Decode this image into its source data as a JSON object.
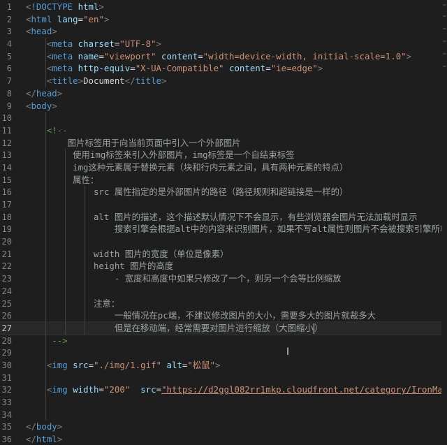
{
  "editor": {
    "language": "html",
    "current_line": 27,
    "lines": [
      {
        "n": "1",
        "indent": 0,
        "segs": [
          [
            "br",
            "<"
          ],
          [
            "tag",
            "!DOCTYPE"
          ],
          [
            "txt",
            " "
          ],
          [
            "attr",
            "html"
          ],
          [
            "br",
            ">"
          ]
        ]
      },
      {
        "n": "2",
        "indent": 0,
        "segs": [
          [
            "br",
            "<"
          ],
          [
            "tag",
            "html"
          ],
          [
            "txt",
            " "
          ],
          [
            "attr",
            "lang"
          ],
          [
            "txt",
            "="
          ],
          [
            "str",
            "\"en\""
          ],
          [
            "br",
            ">"
          ]
        ]
      },
      {
        "n": "3",
        "indent": 0,
        "segs": [
          [
            "br",
            "<"
          ],
          [
            "tag",
            "head"
          ],
          [
            "br",
            ">"
          ]
        ]
      },
      {
        "n": "4",
        "indent": 1,
        "segs": [
          [
            "br",
            "<"
          ],
          [
            "tag",
            "meta"
          ],
          [
            "txt",
            " "
          ],
          [
            "attr",
            "charset"
          ],
          [
            "txt",
            "="
          ],
          [
            "str",
            "\"UTF-8\""
          ],
          [
            "br",
            ">"
          ]
        ]
      },
      {
        "n": "5",
        "indent": 1,
        "segs": [
          [
            "br",
            "<"
          ],
          [
            "tag",
            "meta"
          ],
          [
            "txt",
            " "
          ],
          [
            "attr",
            "name"
          ],
          [
            "txt",
            "="
          ],
          [
            "str",
            "\"viewport\""
          ],
          [
            "txt",
            " "
          ],
          [
            "attr",
            "content"
          ],
          [
            "txt",
            "="
          ],
          [
            "str",
            "\"width=device-width, initial-scale=1.0\""
          ],
          [
            "br",
            ">"
          ]
        ]
      },
      {
        "n": "6",
        "indent": 1,
        "segs": [
          [
            "br",
            "<"
          ],
          [
            "tag",
            "meta"
          ],
          [
            "txt",
            " "
          ],
          [
            "attr",
            "http-equiv"
          ],
          [
            "txt",
            "="
          ],
          [
            "str",
            "\"X-UA-Compatible\""
          ],
          [
            "txt",
            " "
          ],
          [
            "attr",
            "content"
          ],
          [
            "txt",
            "="
          ],
          [
            "str",
            "\"ie=edge\""
          ],
          [
            "br",
            ">"
          ]
        ]
      },
      {
        "n": "7",
        "indent": 1,
        "segs": [
          [
            "br",
            "<"
          ],
          [
            "tag",
            "title"
          ],
          [
            "br",
            ">"
          ],
          [
            "txt",
            "Document"
          ],
          [
            "br",
            "</"
          ],
          [
            "tag",
            "title"
          ],
          [
            "br",
            ">"
          ]
        ]
      },
      {
        "n": "8",
        "indent": 0,
        "segs": [
          [
            "br",
            "</"
          ],
          [
            "tag",
            "head"
          ],
          [
            "br",
            ">"
          ]
        ]
      },
      {
        "n": "9",
        "indent": 0,
        "segs": [
          [
            "br",
            "<"
          ],
          [
            "tag",
            "body"
          ],
          [
            "br",
            ">"
          ]
        ]
      },
      {
        "n": "10",
        "indent": 1,
        "segs": []
      },
      {
        "n": "11",
        "indent": 1,
        "segs": [
          [
            "cm",
            "    <!--"
          ]
        ]
      },
      {
        "n": "12",
        "indent": 1,
        "segs": [
          [
            "cmt",
            "        图片标签用于向当前页面中引入一个外部图片"
          ]
        ]
      },
      {
        "n": "13",
        "indent": 2,
        "segs": [
          [
            "cmt",
            "         使用img标签来引入外部图片，img标签是一个自结束标签"
          ]
        ]
      },
      {
        "n": "14",
        "indent": 2,
        "segs": [
          [
            "cmt",
            "         img这种元素属于替换元素（块和行内元素之间，具有两种元素的特点）"
          ]
        ]
      },
      {
        "n": "15",
        "indent": 2,
        "segs": [
          [
            "cmt",
            "         属性："
          ]
        ]
      },
      {
        "n": "16",
        "indent": 3,
        "segs": [
          [
            "cmt",
            "             src 属性指定的是外部图片的路径（路径规则和超链接是一样的）"
          ]
        ]
      },
      {
        "n": "17",
        "indent": 3,
        "segs": []
      },
      {
        "n": "18",
        "indent": 3,
        "segs": [
          [
            "cmt",
            "             alt 图片的描述，这个描述默认情况下不会显示，有些浏览器会图片无法加载时显示"
          ]
        ]
      },
      {
        "n": "19",
        "indent": 3,
        "segs": [
          [
            "cmt",
            "                 搜索引擎会根据alt中的内容来识别图片，如果不写alt属性则图片不会被搜索引擎所收录"
          ]
        ]
      },
      {
        "n": "20",
        "indent": 3,
        "segs": []
      },
      {
        "n": "21",
        "indent": 3,
        "segs": [
          [
            "cmt",
            "             width 图片的宽度（单位是像素）"
          ]
        ]
      },
      {
        "n": "22",
        "indent": 3,
        "segs": [
          [
            "cmt",
            "             height 图片的高度"
          ]
        ]
      },
      {
        "n": "23",
        "indent": 3,
        "segs": [
          [
            "cmt",
            "                 - 宽度和高度中如果只修改了一个，则另一个会等比例缩放"
          ]
        ]
      },
      {
        "n": "24",
        "indent": 3,
        "segs": []
      },
      {
        "n": "25",
        "indent": 3,
        "segs": [
          [
            "cmt",
            "             注意："
          ]
        ]
      },
      {
        "n": "26",
        "indent": 3,
        "segs": [
          [
            "cmt",
            "                 一般情况在pc端，不建议修改图片的大小，需要多大的图片就裁多大"
          ]
        ]
      },
      {
        "n": "27",
        "indent": 3,
        "segs": [
          [
            "cmt",
            "                 但是在移动端，经常需要对图片进行缩放（大图缩小"
          ],
          [
            "cursor",
            ""
          ],
          [
            "cmt",
            "）"
          ]
        ]
      },
      {
        "n": "28",
        "indent": 1,
        "segs": [
          [
            "cm",
            "     -->"
          ]
        ]
      },
      {
        "n": "29",
        "indent": 1,
        "segs": []
      },
      {
        "n": "30",
        "indent": 1,
        "segs": [
          [
            "txt",
            "    "
          ],
          [
            "br",
            "<"
          ],
          [
            "tag",
            "img"
          ],
          [
            "txt",
            " "
          ],
          [
            "attr",
            "src"
          ],
          [
            "txt",
            "="
          ],
          [
            "str",
            "\"./img/1.gif\""
          ],
          [
            "txt",
            " "
          ],
          [
            "attr",
            "alt"
          ],
          [
            "txt",
            "="
          ],
          [
            "str",
            "\"松鼠\""
          ],
          [
            "br",
            ">"
          ]
        ]
      },
      {
        "n": "31",
        "indent": 1,
        "segs": []
      },
      {
        "n": "32",
        "indent": 1,
        "segs": [
          [
            "txt",
            "    "
          ],
          [
            "br",
            "<"
          ],
          [
            "tag",
            "img"
          ],
          [
            "txt",
            " "
          ],
          [
            "attr",
            "width"
          ],
          [
            "txt",
            "="
          ],
          [
            "str",
            "\"200\""
          ],
          [
            "txt",
            "  "
          ],
          [
            "attr",
            "src"
          ],
          [
            "txt",
            "="
          ],
          [
            "url",
            "\"https://d2ggl082rr1mkp.cloudfront.net/category/IronMan_pre"
          ]
        ]
      },
      {
        "n": "33",
        "indent": 1,
        "segs": []
      },
      {
        "n": "34",
        "indent": 1,
        "segs": []
      },
      {
        "n": "35",
        "indent": 0,
        "segs": [
          [
            "br",
            "</"
          ],
          [
            "tag",
            "body"
          ],
          [
            "br",
            ">"
          ]
        ]
      },
      {
        "n": "36",
        "indent": 0,
        "segs": [
          [
            "br",
            "</"
          ],
          [
            "tag",
            "html"
          ],
          [
            "br",
            ">"
          ]
        ]
      }
    ]
  }
}
